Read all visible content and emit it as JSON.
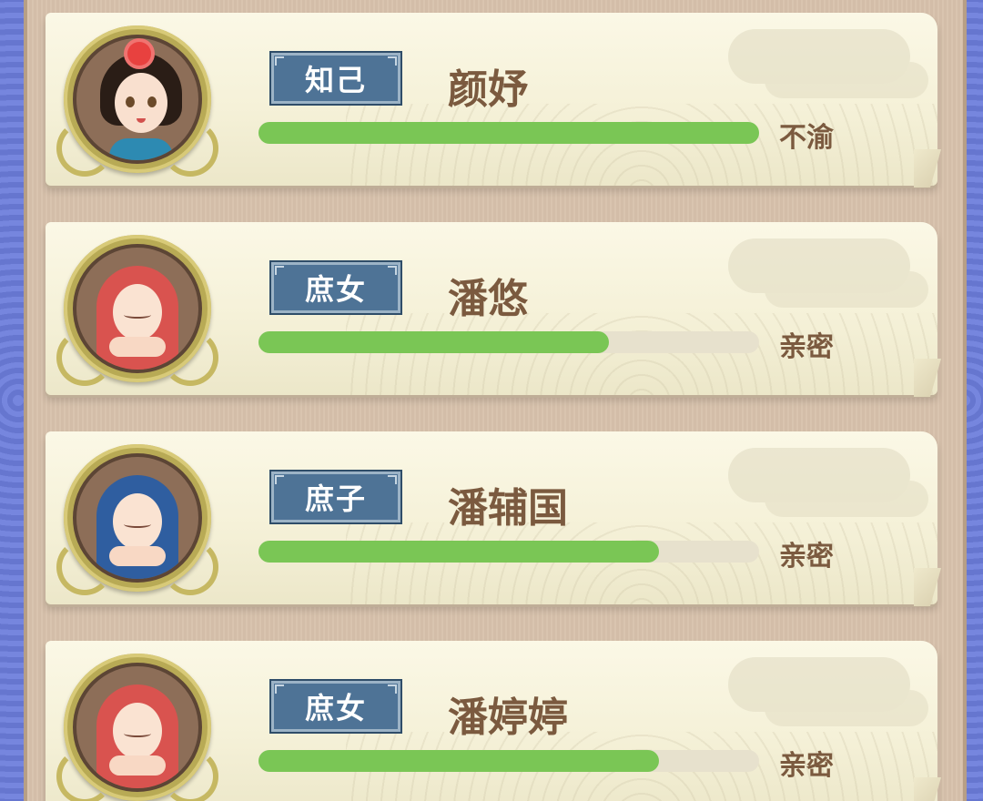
{
  "characters": [
    {
      "rank": "知己",
      "name": "颜妤",
      "status": "不渝",
      "affinity_progress": 1.0,
      "portrait": "lady-with-red-flower-icon"
    },
    {
      "rank": "庶女",
      "name": "潘悠",
      "status": "亲密",
      "affinity_progress": 0.7,
      "portrait": "baby-in-red-hood-icon"
    },
    {
      "rank": "庶子",
      "name": "潘辅国",
      "status": "亲密",
      "affinity_progress": 0.8,
      "portrait": "baby-in-blue-hood-icon"
    },
    {
      "rank": "庶女",
      "name": "潘婷婷",
      "status": "亲密",
      "affinity_progress": 0.8,
      "portrait": "baby-in-red-hood-icon"
    }
  ],
  "colors": {
    "progress_fill": "#7ac655",
    "badge_background": "#4e7396",
    "name_text": "#7b5a3f"
  }
}
